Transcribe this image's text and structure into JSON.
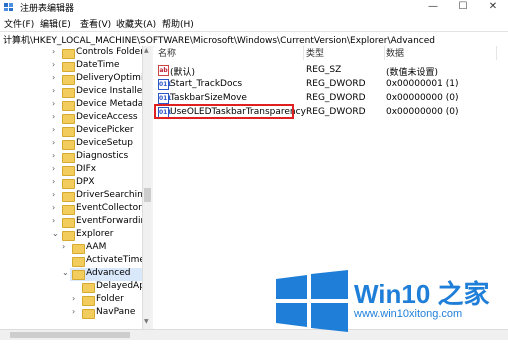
{
  "window": {
    "title": "注册表编辑器",
    "minimize": "—",
    "maximize": "☐",
    "close": "✕",
    "icon": "registry-editor-icon"
  },
  "menu": [
    "文件(F)",
    "编辑(E)",
    "查看(V)",
    "收藏夹(A)",
    "帮助(H)"
  ],
  "address": "计算机\\HKEY_LOCAL_MACHINE\\SOFTWARE\\Microsoft\\Windows\\CurrentVersion\\Explorer\\Advanced",
  "tree": [
    {
      "label": "Controls Folder",
      "expander": "›"
    },
    {
      "label": "DateTime",
      "expander": "›"
    },
    {
      "label": "DeliveryOptimiza",
      "expander": "›"
    },
    {
      "label": "Device Installer",
      "expander": "›"
    },
    {
      "label": "Device Metadata",
      "expander": "›"
    },
    {
      "label": "DeviceAccess",
      "expander": "›"
    },
    {
      "label": "DevicePicker",
      "expander": "›"
    },
    {
      "label": "DeviceSetup",
      "expander": "›"
    },
    {
      "label": "Diagnostics",
      "expander": "›"
    },
    {
      "label": "DIFx",
      "expander": "›"
    },
    {
      "label": "DPX",
      "expander": "›"
    },
    {
      "label": "DriverSearching",
      "expander": "›"
    },
    {
      "label": "EventCollector",
      "expander": "›"
    },
    {
      "label": "EventForwarding",
      "expander": "›"
    },
    {
      "label": "Explorer",
      "expander": "⌄"
    },
    {
      "label": "AAM",
      "expander": "›"
    },
    {
      "label": "ActivateTimec",
      "expander": ""
    },
    {
      "label": "Advanced",
      "expander": "⌄"
    },
    {
      "label": "DelayedAp",
      "expander": ""
    },
    {
      "label": "Folder",
      "expander": "›"
    },
    {
      "label": "NavPane",
      "expander": "›"
    }
  ],
  "columns": {
    "name": "名称",
    "type": "类型",
    "data": "数据"
  },
  "values": [
    {
      "icon": "ab",
      "name": "(默认)",
      "type": "REG_SZ",
      "data": "(数值未设置)"
    },
    {
      "icon": "011",
      "name": "Start_TrackDocs",
      "type": "REG_DWORD",
      "data": "0x00000001 (1)"
    },
    {
      "icon": "011",
      "name": "TaskbarSizeMove",
      "type": "REG_DWORD",
      "data": "0x00000000 (0)"
    },
    {
      "icon": "011",
      "name": "UseOLEDTaskbarTransparency",
      "type": "REG_DWORD",
      "data": "0x00000000 (0)"
    }
  ],
  "watermark": {
    "title": "Win10 之家",
    "url": "www.win10xitong.com",
    "logo_color": "#1f7fd8"
  }
}
